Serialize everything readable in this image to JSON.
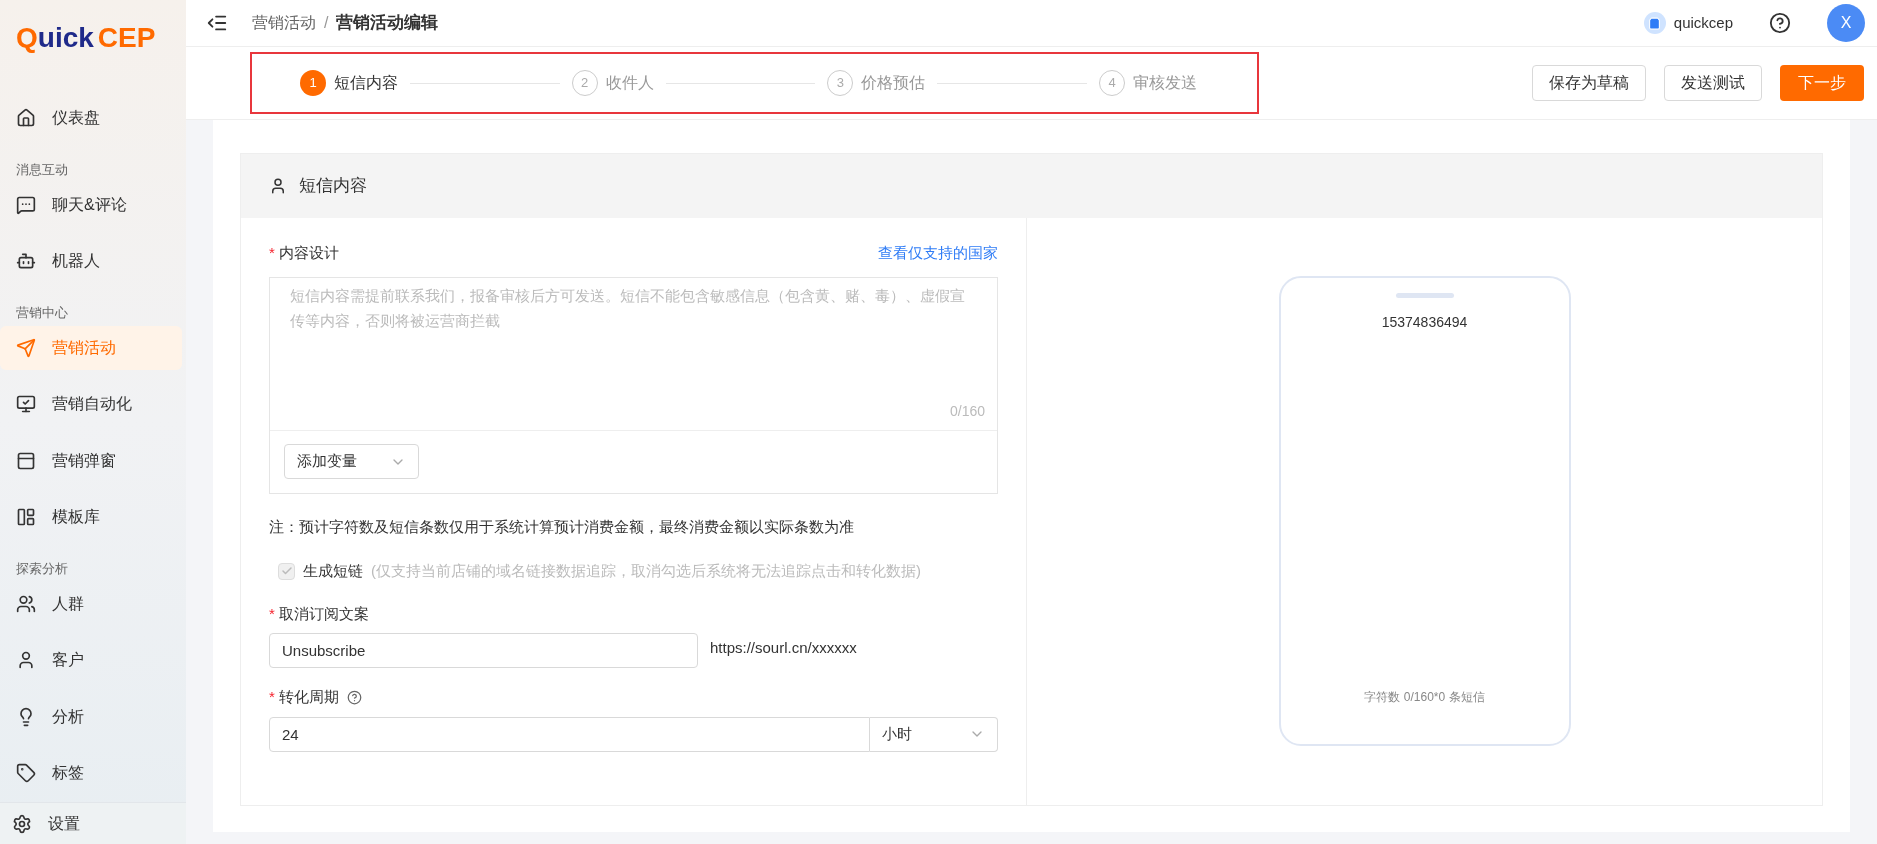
{
  "sidebar": {
    "logo": [
      "Q",
      "uick",
      "CEP"
    ],
    "nav": [
      {
        "kind": "item",
        "label": "仪表盘",
        "selected": false
      },
      {
        "kind": "section",
        "label": "消息互动"
      },
      {
        "kind": "item",
        "label": "聊天&评论",
        "selected": false
      },
      {
        "kind": "item",
        "label": "机器人",
        "selected": false
      },
      {
        "kind": "section",
        "label": "营销中心"
      },
      {
        "kind": "item",
        "label": "营销活动",
        "selected": true
      },
      {
        "kind": "item",
        "label": "营销自动化",
        "selected": false
      },
      {
        "kind": "item",
        "label": "营销弹窗",
        "selected": false
      },
      {
        "kind": "item",
        "label": "模板库",
        "selected": false
      },
      {
        "kind": "section",
        "label": "探索分析"
      },
      {
        "kind": "item",
        "label": "人群",
        "selected": false
      },
      {
        "kind": "item",
        "label": "客户",
        "selected": false
      },
      {
        "kind": "item",
        "label": "分析",
        "selected": false
      },
      {
        "kind": "item",
        "label": "标签",
        "selected": false
      }
    ],
    "footer": "设置"
  },
  "topbar": {
    "breadcrumb": [
      "营销活动",
      "营销活动编辑"
    ],
    "separator": "/",
    "shop": "quickcep",
    "avatar": "X"
  },
  "steps": [
    {
      "number": "1",
      "label": "短信内容",
      "selected": true
    },
    {
      "number": "2",
      "label": "收件人",
      "selected": false
    },
    {
      "number": "3",
      "label": "价格预估",
      "selected": false
    },
    {
      "number": "4",
      "label": "审核发送",
      "selected": false
    }
  ],
  "actions": [
    {
      "label": "保存为草稿",
      "kind": "default"
    },
    {
      "label": "发送测试",
      "kind": "default"
    },
    {
      "label": "下一步",
      "kind": "primary"
    }
  ],
  "card": {
    "title": "短信内容",
    "content": {
      "label": "内容设计",
      "required_mark": "*",
      "link": "查看仅支持的国家",
      "placeholder": "短信内容需提前联系我们，报备审核后方可发送。短信不能包含敏感信息（包含黄、赌、毒）、虚假宣传等内容，否则将被运营商拦截",
      "counter": "0/160",
      "variable_select": "添加变量"
    },
    "note": "注：预计字符数及短信条数仅用于系统计算预计消费金额，最终消费金额以实际条数为准",
    "short_link": {
      "checked": true,
      "disabled": true,
      "label": "生成短链",
      "hint": "(仅支持当前店铺的域名链接数据追踪，取消勾选后系统将无法追踪点击和转化数据)"
    },
    "unsubscribe": {
      "label": "取消订阅文案",
      "required_mark": "*",
      "value": "Unsubscribe",
      "url": "https://sourl.cn/xxxxxx"
    },
    "conversion": {
      "label": "转化周期",
      "required_mark": "*",
      "value": "24",
      "unit": "小时"
    },
    "preview": {
      "phone": "15374836494",
      "footer": "字符数 0/160*0 条短信"
    }
  }
}
